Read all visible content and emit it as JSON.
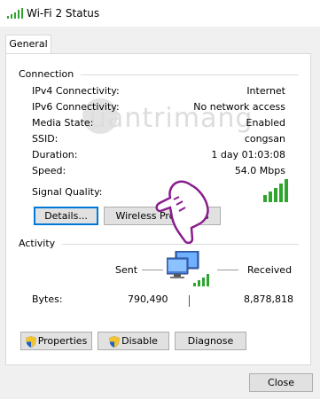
{
  "window": {
    "title": "Wi-Fi 2 Status"
  },
  "tabs": [
    {
      "label": "General"
    }
  ],
  "connection": {
    "heading": "Connection",
    "rows": [
      {
        "label": "IPv4 Connectivity:",
        "value": "Internet"
      },
      {
        "label": "IPv6 Connectivity:",
        "value": "No network access"
      },
      {
        "label": "Media State:",
        "value": "Enabled"
      },
      {
        "label": "SSID:",
        "value": "congsan"
      },
      {
        "label": "Duration:",
        "value": "1 day 01:03:08"
      },
      {
        "label": "Speed:",
        "value": "54.0 Mbps"
      }
    ],
    "signal_label": "Signal Quality:",
    "signal_bars_filled": 5,
    "signal_bars_total": 5
  },
  "buttons": {
    "details": "Details...",
    "wireless_properties": "Wireless Properties",
    "properties": "Properties",
    "disable": "Disable",
    "diagnose": "Diagnose",
    "close": "Close"
  },
  "activity": {
    "heading": "Activity",
    "sent_label": "Sent",
    "received_label": "Received",
    "bytes_label": "Bytes:",
    "bytes_sent": "790,490",
    "bytes_received": "8,878,818"
  },
  "watermark": {
    "text": "uantrimang"
  },
  "colors": {
    "signal_green": "#2fa52f",
    "shield_blue": "#1f5fbf",
    "shield_yellow": "#f2c230",
    "hand_purple": "#8a1d8e",
    "focus_blue": "#0078d7"
  }
}
